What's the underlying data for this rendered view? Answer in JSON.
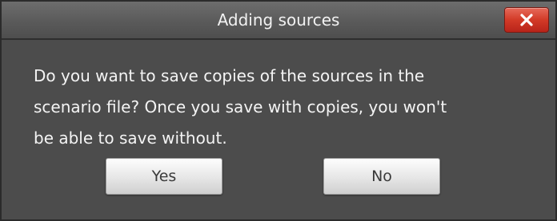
{
  "dialog": {
    "title": "Adding sources",
    "close_icon": "close-icon",
    "message": "Do you want to save copies of the sources in the scenario file? Once you save with copies, you won't be able to save without.",
    "message_lines": [
      "Do you want to save copies of the sources in the",
      "scenario file? Once you save with copies, you won't",
      "be able to save without."
    ],
    "buttons": {
      "yes_label": "Yes",
      "no_label": "No"
    }
  },
  "colors": {
    "background": "#4c4c4c",
    "close_button": "#d23a27",
    "text": "#f4f4f4"
  }
}
